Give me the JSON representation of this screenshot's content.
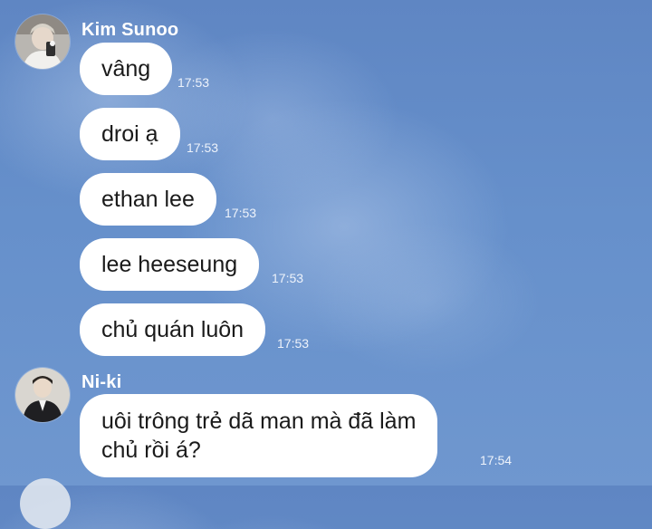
{
  "conversation": {
    "groups": [
      {
        "sender": "Kim Sunoo",
        "avatar_icon": "user-avatar-kim-sunoo",
        "messages": [
          {
            "text": "vâng",
            "time": "17:53"
          },
          {
            "text": "droi ạ",
            "time": "17:53"
          },
          {
            "text": "ethan lee",
            "time": "17:53"
          },
          {
            "text": "lee heeseung",
            "time": "17:53"
          },
          {
            "text": "chủ quán luôn",
            "time": "17:53"
          }
        ]
      },
      {
        "sender": "Ni-ki",
        "avatar_icon": "user-avatar-ni-ki",
        "messages": [
          {
            "text": "uôi trông trẻ dã man mà đã làm\nchủ rồi á?",
            "time": "17:54"
          }
        ]
      }
    ]
  },
  "colors": {
    "background": "#6690cb",
    "bubble": "#ffffff",
    "text": "#1a1a1a",
    "meta_text": "#ffffff"
  }
}
